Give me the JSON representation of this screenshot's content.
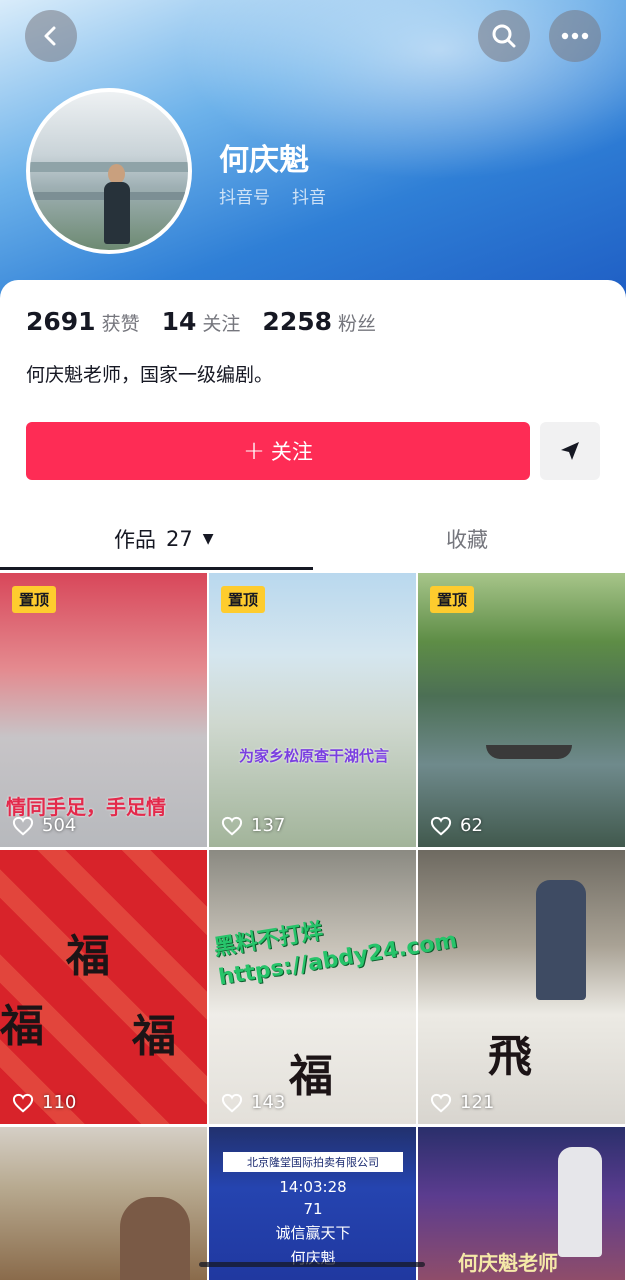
{
  "profile": {
    "name": "何庆魁",
    "sub_label_1": "抖音号",
    "sub_label_2": "抖音",
    "bio": "何庆魁老师，国家一级编剧。"
  },
  "stats": [
    {
      "value": "2691",
      "label": "获赞"
    },
    {
      "value": "14",
      "label": "关注"
    },
    {
      "value": "2258",
      "label": "粉丝"
    }
  ],
  "actions": {
    "follow_plus": "+",
    "follow_label": "关注"
  },
  "tabs": {
    "works_label": "作品",
    "works_count": "27",
    "works_caret": "▼",
    "favorites_label": "收藏"
  },
  "videos": [
    {
      "pinned": "置顶",
      "likes": "504",
      "caption": "情同手足，手足情"
    },
    {
      "pinned": "置顶",
      "likes": "137",
      "caption": "为家乡松原查干湖代言"
    },
    {
      "pinned": "置顶",
      "likes": "62"
    },
    {
      "likes": "110"
    },
    {
      "likes": "143"
    },
    {
      "likes": "121"
    },
    {
      "auction_line1": "北京隆堂国际拍卖有限公司",
      "auction_time": "14:03:28",
      "auction_num": "71",
      "auction_slogan": "诚信赢天下",
      "auction_name": "何庆魁"
    },
    {},
    {
      "caption": "何庆魁老师"
    }
  ],
  "calligraphy": {
    "fu": "福",
    "fei": "飛",
    "fu_small": "福"
  },
  "watermark": {
    "line1": "黑料不打烊",
    "line2": "https://abdy24.com"
  },
  "colors": {
    "follow": "#fe2c55",
    "pin_badge": "#fecc2e",
    "watermark": "#26c46a"
  }
}
